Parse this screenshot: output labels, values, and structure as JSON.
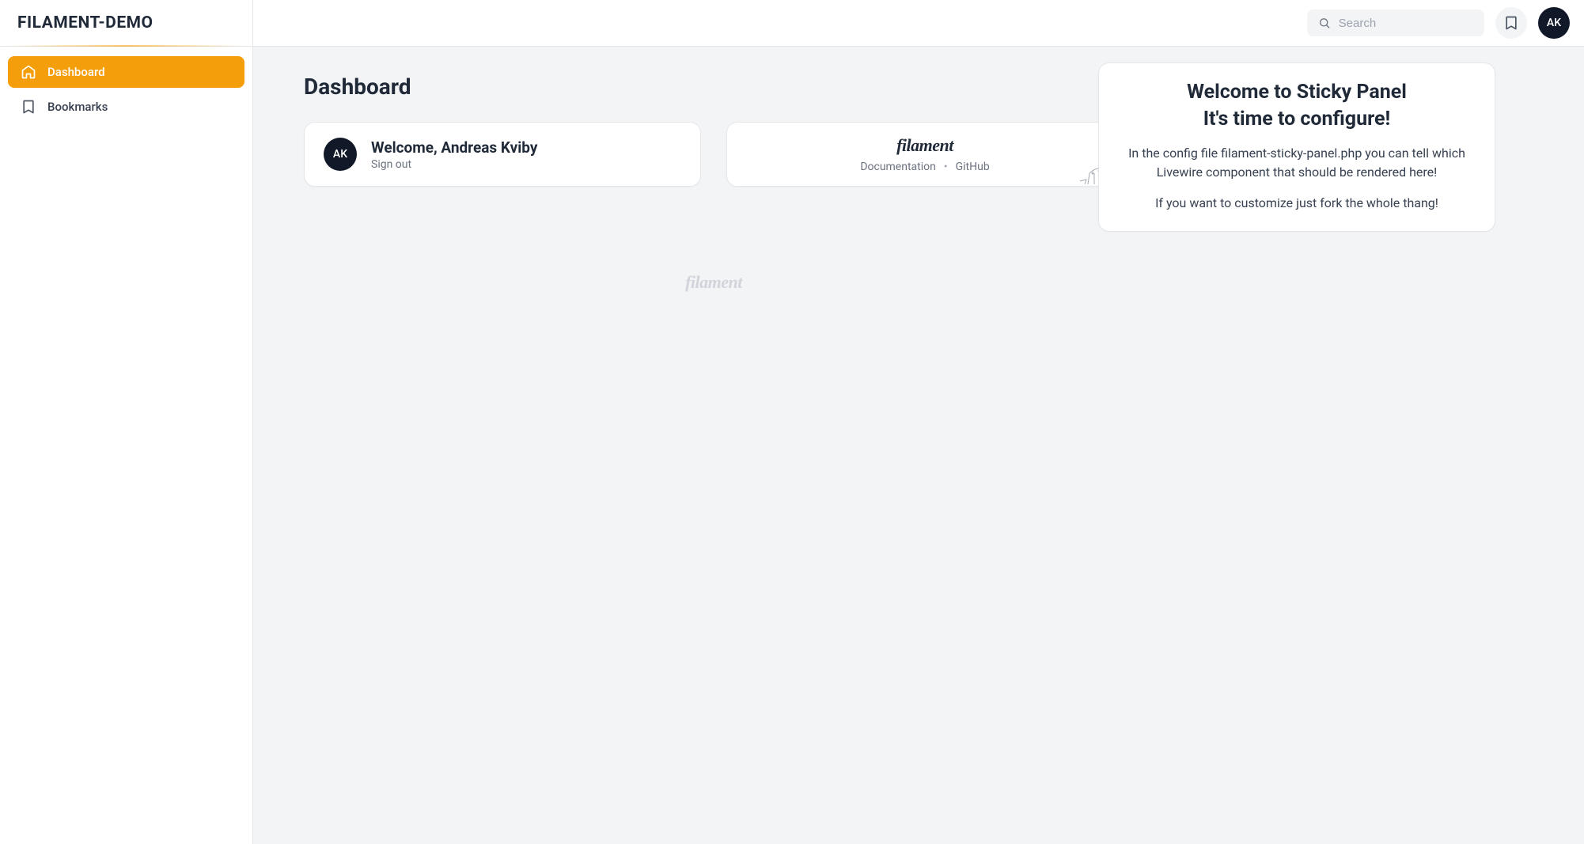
{
  "brand": "FILAMENT-DEMO",
  "sidebar": {
    "items": [
      {
        "label": "Dashboard",
        "icon": "home-icon",
        "active": true
      },
      {
        "label": "Bookmarks",
        "icon": "bookmark-icon",
        "active": false
      }
    ]
  },
  "header": {
    "search_placeholder": "Search",
    "avatar_initials": "AK"
  },
  "page": {
    "title": "Dashboard"
  },
  "welcome_card": {
    "avatar_initials": "AK",
    "greeting": "Welcome, Andreas Kviby",
    "signout_label": "Sign out"
  },
  "filament_card": {
    "logo_text": "filament",
    "link_documentation": "Documentation",
    "link_github": "GitHub"
  },
  "footer": {
    "logo_text": "filament"
  },
  "sticky_panel": {
    "heading_line1": "Welcome to Sticky Panel",
    "heading_line2": "It's time to configure!",
    "body1": "In the config file filament-sticky-panel.php you can tell which Livewire component that should be rendered here!",
    "body2": "If you want to customize just fork the whole thang!"
  }
}
